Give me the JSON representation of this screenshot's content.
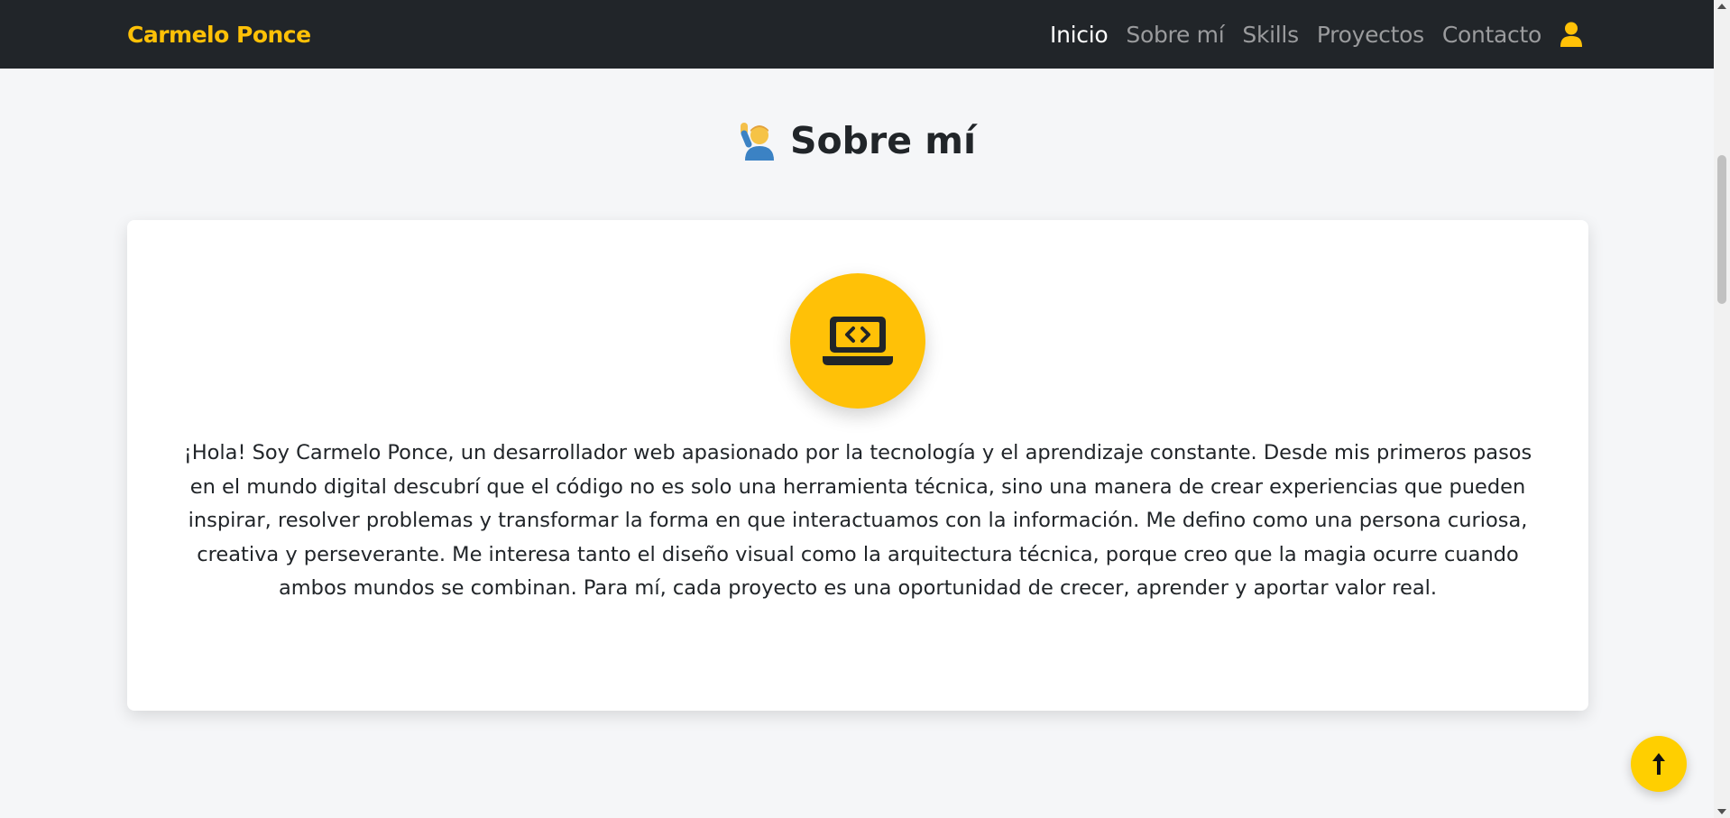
{
  "navbar": {
    "brand": "Carmelo Ponce",
    "links": [
      {
        "label": "Inicio",
        "active": true
      },
      {
        "label": "Sobre mí",
        "active": false
      },
      {
        "label": "Skills",
        "active": false
      },
      {
        "label": "Proyectos",
        "active": false
      },
      {
        "label": "Contacto",
        "active": false
      }
    ],
    "user_icon": "user-icon"
  },
  "section": {
    "title": "Sobre mí",
    "title_icon": "person-raising-hand-emoji",
    "card_icon": "laptop-code-icon",
    "bio": "¡Hola! Soy Carmelo Ponce, un desarrollador web apasionado por la tecnología y el aprendizaje constante. Desde mis primeros pasos en el mundo digital descubrí que el código no es solo una herramienta técnica, sino una manera de crear experiencias que pueden inspirar, resolver problemas y transformar la forma en que interactuamos con la información. Me defino como una persona curiosa, creativa y perseverante. Me interesa tanto el diseño visual como la arquitectura técnica, porque creo que la magia ocurre cuando ambos mundos se combinan. Para mí, cada proyecto es una oportunidad de crecer, aprender y aportar valor real."
  },
  "back_to_top": {
    "icon": "arrow-up-icon"
  },
  "colors": {
    "navbar_bg": "#212529",
    "accent": "#ffc107",
    "page_bg": "#f5f6f8",
    "text": "#212529",
    "nav_inactive": "#9a9b9d"
  }
}
